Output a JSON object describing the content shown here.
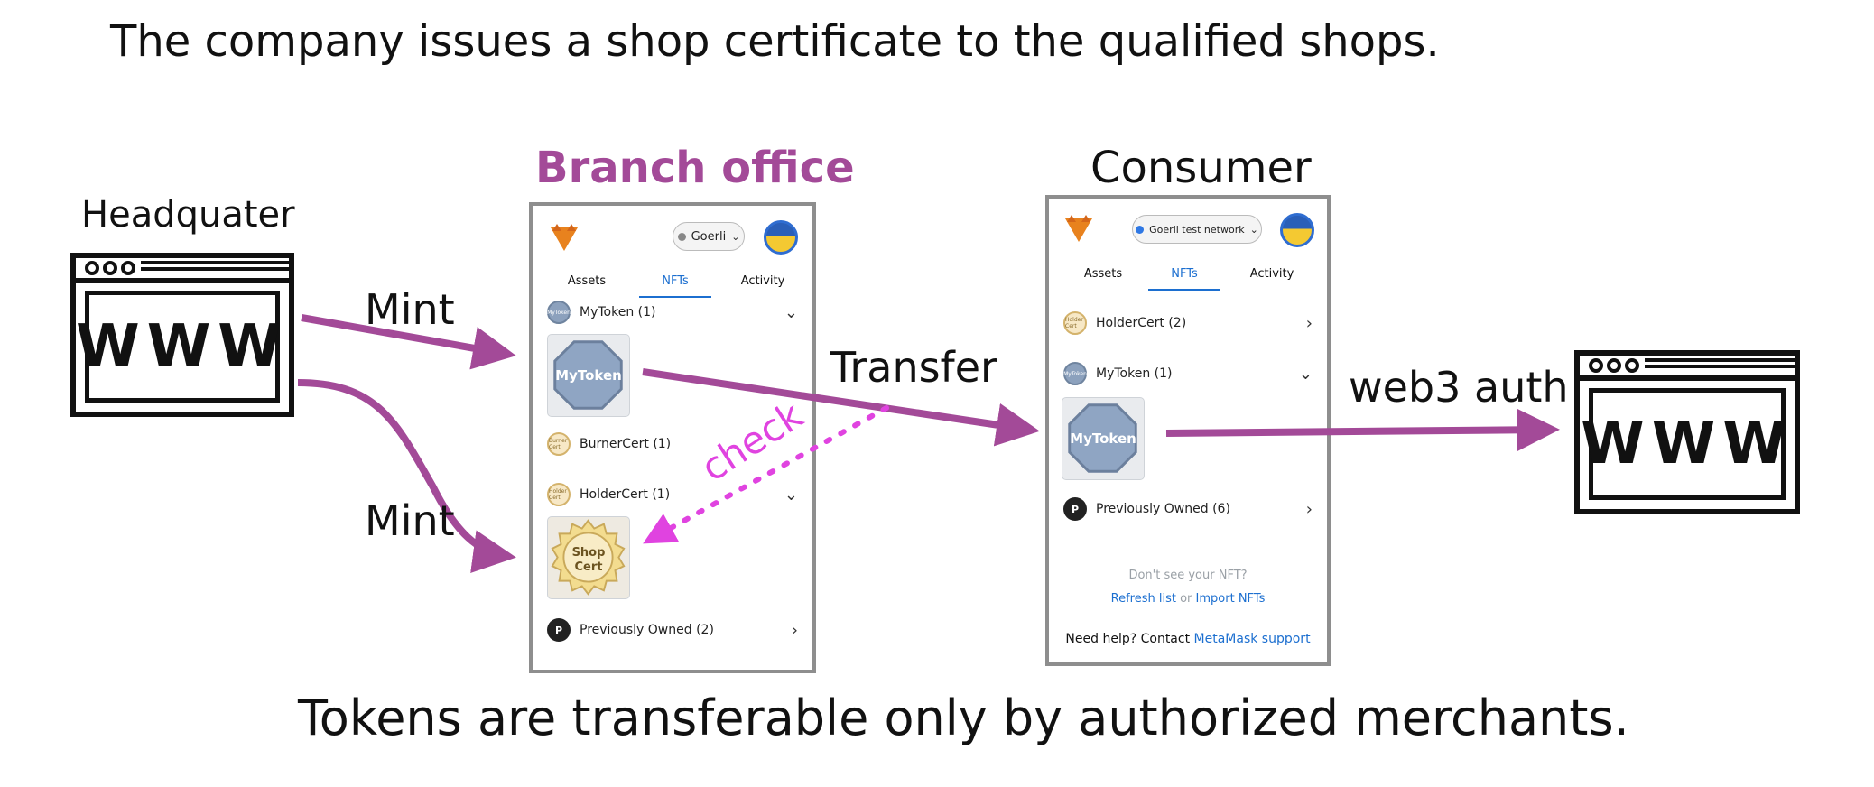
{
  "header": {
    "title": "The company issues a shop certificate to the qualified shops."
  },
  "footer": {
    "text": "Tokens are transferable only by authorized merchants."
  },
  "nodes": {
    "headquarter": {
      "label": "Headquater",
      "browser_text": "WWW"
    },
    "branch": {
      "label": "Branch office"
    },
    "consumer": {
      "label": "Consumer"
    },
    "site": {
      "browser_text": "WWW"
    }
  },
  "arrows": {
    "mint_top": "Mint",
    "mint_bottom": "Mint",
    "transfer": "Transfer",
    "web3_auth": "web3 auth",
    "check": "check"
  },
  "colors": {
    "arrow": "#a34a98",
    "check": "#e043e0",
    "branch_title": "#a34a98"
  },
  "branch_wallet": {
    "network": "Goerli",
    "tabs": [
      "Assets",
      "NFTs",
      "Activity"
    ],
    "active_tab": "NFTs",
    "collections": [
      {
        "name": "MyToken (1)",
        "badge": "MyToken"
      },
      {
        "name": "BurnerCert (1)",
        "badge": "Burner Cert"
      },
      {
        "name": "HolderCert (1)",
        "badge": "Holder Cert"
      },
      {
        "name": "Previously Owned (2)",
        "badge": "P"
      }
    ],
    "nft_token_label": "MyToken",
    "nft_cert_label_1": "Shop",
    "nft_cert_label_2": "Cert"
  },
  "consumer_wallet": {
    "network": "Goerli test network",
    "tabs": [
      "Assets",
      "NFTs",
      "Activity"
    ],
    "active_tab": "NFTs",
    "collections": [
      {
        "name": "HolderCert (2)",
        "badge": "Holder Cert"
      },
      {
        "name": "MyToken (1)",
        "badge": "MyToken"
      },
      {
        "name": "Previously Owned (6)",
        "badge": "P"
      }
    ],
    "nft_token_label": "MyToken",
    "empty_hint": "Don't see your NFT?",
    "refresh_link": "Refresh list",
    "or_text": "or",
    "import_link": "Import NFTs",
    "help_text": "Need help? Contact",
    "support_link": "MetaMask support"
  }
}
